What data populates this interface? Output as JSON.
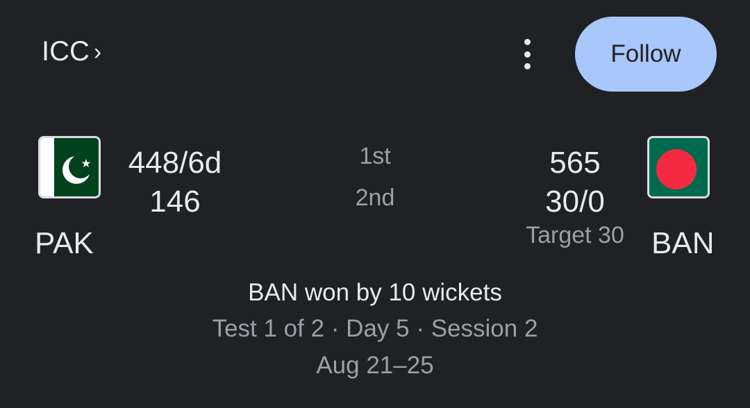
{
  "header": {
    "league": "ICC",
    "follow_label": "Follow"
  },
  "match": {
    "innings_labels": [
      "1st",
      "2nd"
    ],
    "teams": [
      {
        "code": "PAK",
        "scores": [
          "448/6d",
          "146"
        ],
        "flag": "pakistan-flag-icon"
      },
      {
        "code": "BAN",
        "scores": [
          "565",
          "30/0"
        ],
        "target": "Target 30",
        "flag": "bangladesh-flag-icon"
      }
    ],
    "result": "BAN won by 10 wickets",
    "details": "Test 1 of 2 · Day 5 · Session 2",
    "dates": "Aug 21–25"
  },
  "colors": {
    "background": "#202124",
    "follow_button": "#a8c7fa",
    "text_primary": "#e8eaed",
    "text_secondary": "#9aa0a6"
  }
}
